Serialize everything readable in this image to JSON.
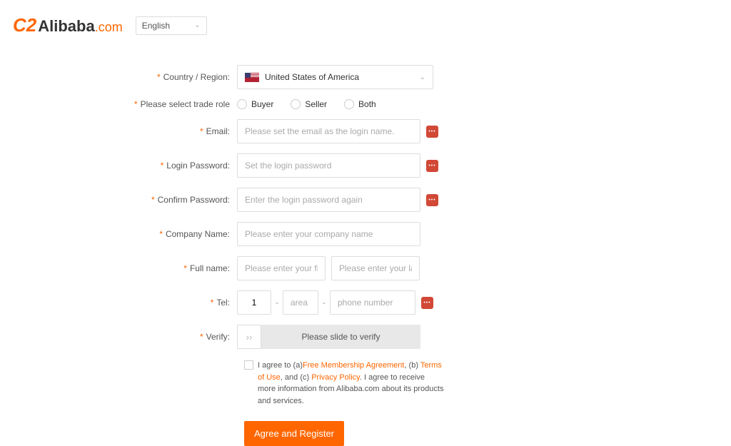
{
  "header": {
    "logo_brand": "Alibaba",
    "logo_suffix": ".com",
    "language": "English"
  },
  "form": {
    "country": {
      "label": "Country / Region:",
      "value": "United States of America"
    },
    "trade": {
      "label": "Please select trade role",
      "opt1": "Buyer",
      "opt2": "Seller",
      "opt3": "Both"
    },
    "email": {
      "label": "Email:",
      "placeholder": "Please set the email as the login name."
    },
    "password": {
      "label": "Login Password:",
      "placeholder": "Set the login password"
    },
    "confirm": {
      "label": "Confirm Password:",
      "placeholder": "Enter the login password again"
    },
    "company": {
      "label": "Company Name:",
      "placeholder": "Please enter your company name"
    },
    "fullname": {
      "label": "Full name:",
      "first_ph": "Please enter your first name",
      "last_ph": "Please enter your last name"
    },
    "tel": {
      "label": "Tel:",
      "country_code": "1",
      "area_ph": "area",
      "phone_ph": "phone number"
    },
    "verify": {
      "label": "Verify:",
      "text": "Please slide to verify"
    },
    "agree": {
      "pre1": "I agree to (a)",
      "link1": "Free Membership Agreement",
      "mid1": ", (b) ",
      "link2": "Terms of Use",
      "mid2": ", and (c) ",
      "link3": "Privacy Policy",
      "post": ". I agree to receive more information from Alibaba.com about its products and services."
    },
    "submit": "Agree and Register"
  }
}
